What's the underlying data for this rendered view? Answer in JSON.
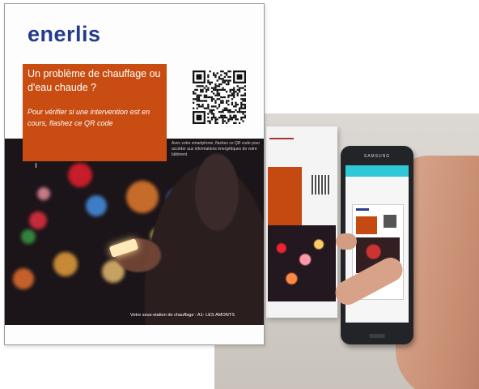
{
  "poster": {
    "brand": "enerlis",
    "headline": "Un problème de chauffage ou d'eau chaude ?",
    "subline": "Pour vérifier si une intervention est en cours, flashez ce QR code",
    "scan_caption": "Avec votre smartphone, flashez ce QR code pour accéder aux informations énergétiques de votre bâtiment",
    "footer": "Votre sous-station de chauffage : A1- LES AMONTS",
    "qr_icon": "qr-code-icon"
  },
  "phone": {
    "brand": "SAMSUNG"
  },
  "colors": {
    "brand_blue": "#243a8c",
    "accent_orange": "#c94d12",
    "app_cyan": "#2ec8d6"
  }
}
